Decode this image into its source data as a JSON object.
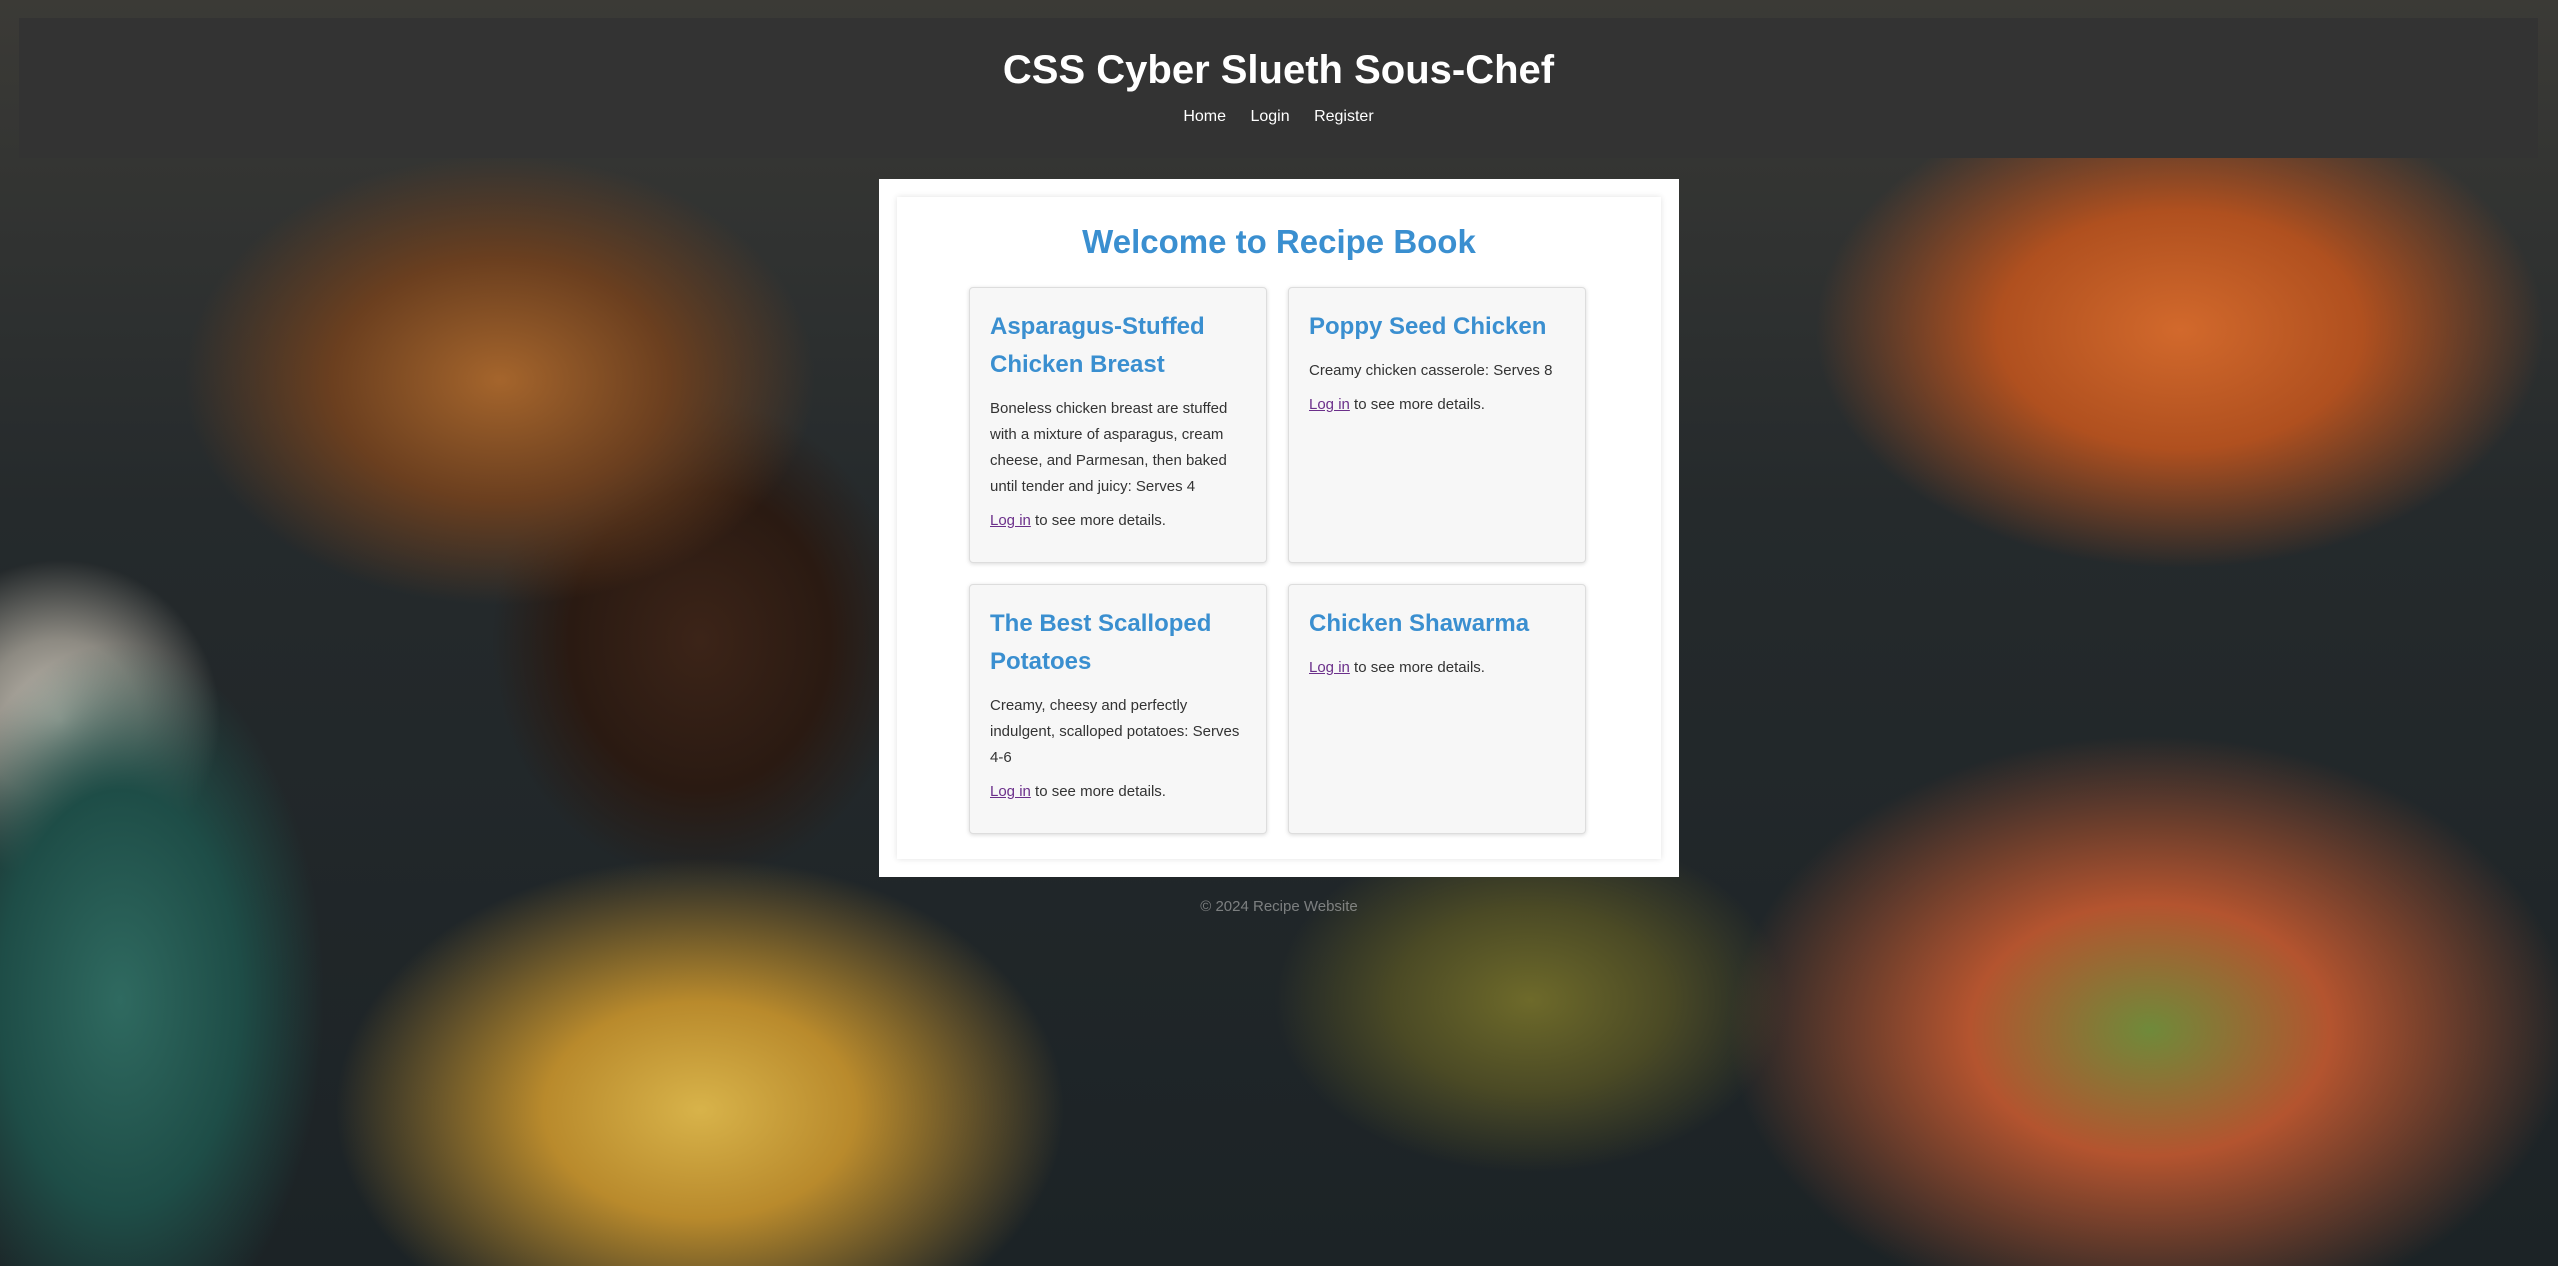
{
  "header": {
    "title": "CSS Cyber Slueth Sous-Chef",
    "nav": [
      "Home",
      "Login",
      "Register"
    ]
  },
  "main": {
    "heading": "Welcome to Recipe Book",
    "login_link": "Log in",
    "login_suffix": " to see more details.",
    "recipes": [
      {
        "title": "Asparagus-Stuffed Chicken Breast",
        "description": "Boneless chicken breast are stuffed with a mixture of asparagus, cream cheese, and Parmesan, then baked until tender and juicy: Serves 4"
      },
      {
        "title": "Poppy Seed Chicken",
        "description": "Creamy chicken casserole: Serves 8"
      },
      {
        "title": "The Best Scalloped Potatoes",
        "description": "Creamy, cheesy and perfectly indulgent, scalloped potatoes: Serves 4-6"
      },
      {
        "title": "Chicken Shawarma",
        "description": ""
      }
    ]
  },
  "footer": {
    "text": "© 2024 Recipe Website"
  },
  "colors": {
    "header_bg": "#333333",
    "accent": "#3a8fd0",
    "link_visited": "#6b2f8a"
  }
}
